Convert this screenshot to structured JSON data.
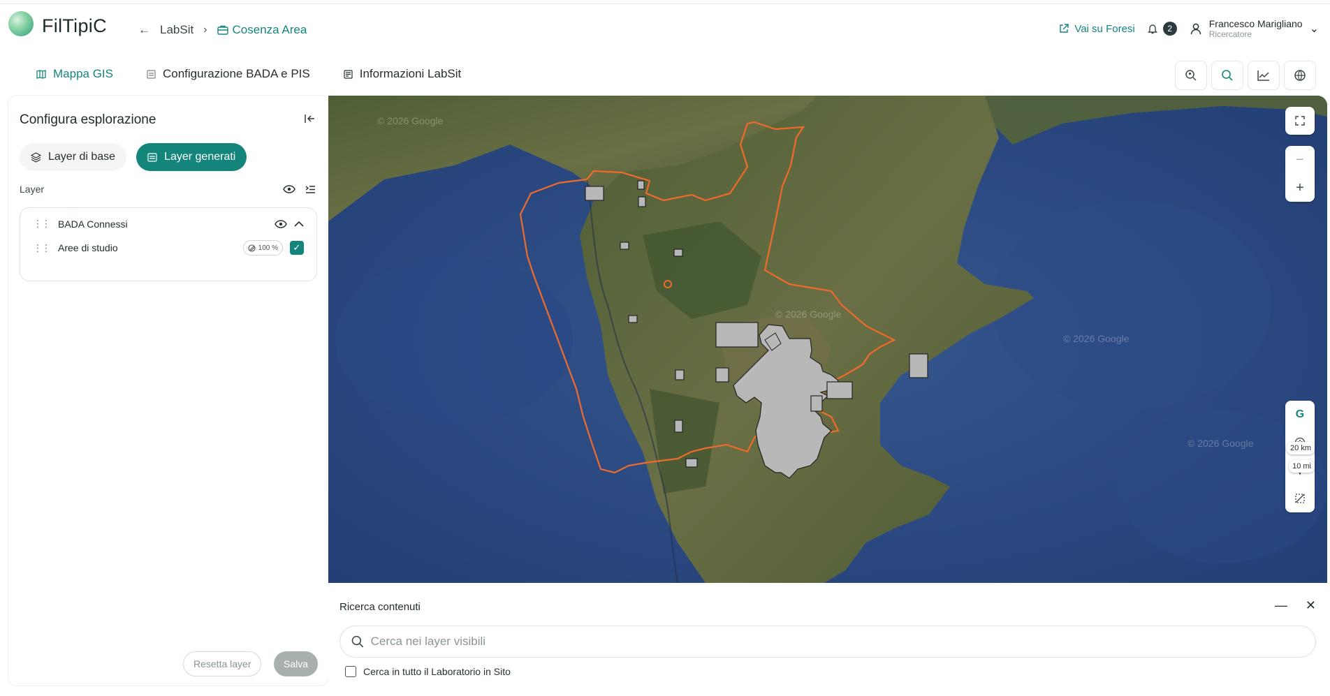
{
  "app": {
    "brand": "FilTipiC"
  },
  "breadcrumb": {
    "back_icon": "arrow-left-icon",
    "root": "LabSit",
    "current": "Cosenza Area"
  },
  "header": {
    "external_link": "Vai su Foresi",
    "notifications_count": "2",
    "user_name": "Francesco Marigliano",
    "user_role": "Ricercatore"
  },
  "tabs": [
    {
      "label": "Mappa GIS",
      "icon": "map-icon",
      "active": true
    },
    {
      "label": "Configurazione BADA e PIS",
      "icon": "config-icon",
      "active": false
    },
    {
      "label": "Informazioni LabSit",
      "icon": "info-doc-icon",
      "active": false
    }
  ],
  "toolbar_icons": [
    "search-location-icon",
    "search-icon",
    "chart-line-icon",
    "layers-globe-icon"
  ],
  "panel": {
    "title": "Configura esplorazione",
    "seg_base": "Layer di base",
    "seg_generated": "Layer generati",
    "layer_label": "Layer",
    "group_name": "BADA Connessi",
    "item_name": "Aree di studio",
    "opacity": "100 %",
    "reset_label": "Resetta layer",
    "save_label": "Salva"
  },
  "map": {
    "scale_km": "20 km",
    "scale_mi": "10 mi",
    "watermark": "© 2026 Google",
    "colors": {
      "boundary": "#f06a2a",
      "area_fill": "#b8b8b8",
      "sea": "#2d4f8c",
      "land": "#5c6b3e"
    }
  },
  "search": {
    "title": "Ricerca contenuti",
    "placeholder": "Cerca nei layer visibili",
    "checkbox_label": "Cerca in tutto il Laboratorio in Sito"
  },
  "colors": {
    "accent": "#13857a"
  }
}
